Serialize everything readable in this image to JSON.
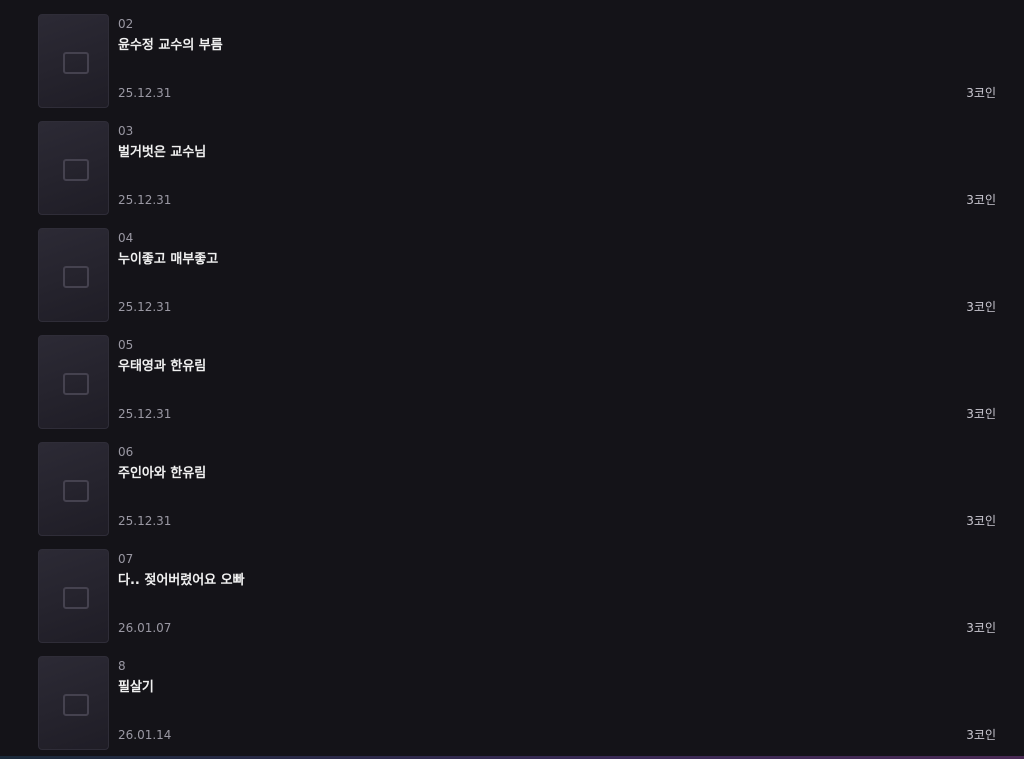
{
  "episodes": [
    {
      "number": "02",
      "title": "윤수정 교수의 부름",
      "date": "25.12.31",
      "price": "3코인",
      "thumbnail": "thumbnail-placeholder"
    },
    {
      "number": "03",
      "title": "벌거벗은 교수님",
      "date": "25.12.31",
      "price": "3코인",
      "thumbnail": "thumbnail-placeholder"
    },
    {
      "number": "04",
      "title": "누이좋고 매부좋고",
      "date": "25.12.31",
      "price": "3코인",
      "thumbnail": "thumbnail-placeholder"
    },
    {
      "number": "05",
      "title": "우태영과 한유림",
      "date": "25.12.31",
      "price": "3코인",
      "thumbnail": "thumbnail-placeholder"
    },
    {
      "number": "06",
      "title": "주인아와 한유림",
      "date": "25.12.31",
      "price": "3코인",
      "thumbnail": "thumbnail-placeholder"
    },
    {
      "number": "07",
      "title": "다.. 젖어버렸어요 오빠",
      "date": "26.01.07",
      "price": "3코인",
      "thumbnail": "thumbnail-placeholder"
    },
    {
      "number": "8",
      "title": "필살기",
      "date": "26.01.14",
      "price": "3코인",
      "thumbnail": "thumbnail-placeholder"
    }
  ]
}
